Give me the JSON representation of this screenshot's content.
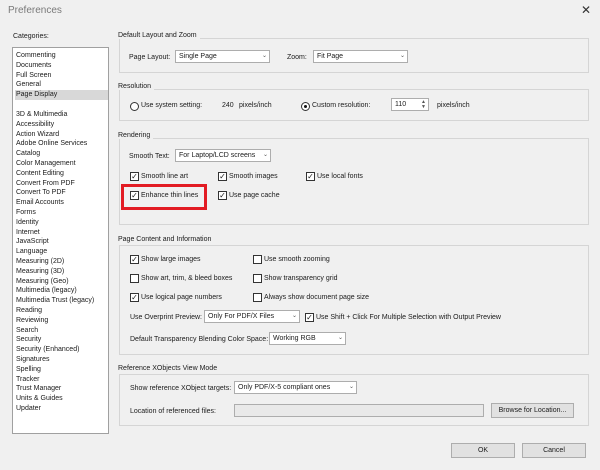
{
  "window": {
    "title": "Preferences",
    "close_glyph": "✕"
  },
  "categories": {
    "label": "Categories:",
    "group1": [
      "Commenting",
      "Documents",
      "Full Screen",
      "General",
      "Page Display"
    ],
    "group2": [
      "3D & Multimedia",
      "Accessibility",
      "Action Wizard",
      "Adobe Online Services",
      "Catalog",
      "Color Management",
      "Content Editing",
      "Convert From PDF",
      "Convert To PDF",
      "Email Accounts",
      "Forms",
      "Identity",
      "Internet",
      "JavaScript",
      "Language",
      "Measuring (2D)",
      "Measuring (3D)",
      "Measuring (Geo)",
      "Multimedia (legacy)",
      "Multimedia Trust (legacy)",
      "Reading",
      "Reviewing",
      "Search",
      "Security",
      "Security (Enhanced)",
      "Signatures",
      "Spelling",
      "Tracker",
      "Trust Manager",
      "Units & Guides",
      "Updater"
    ],
    "selected": "Page Display"
  },
  "layout": {
    "title": "Default Layout and Zoom",
    "page_layout_label": "Page Layout:",
    "page_layout_value": "Single Page",
    "zoom_label": "Zoom:",
    "zoom_value": "Fit Page"
  },
  "resolution": {
    "title": "Resolution",
    "system_label": "Use system setting:",
    "system_value": "240",
    "system_unit": "pixels/inch",
    "custom_label": "Custom resolution:",
    "custom_value": "110",
    "custom_unit": "pixels/inch"
  },
  "rendering": {
    "title": "Rendering",
    "smooth_text_label": "Smooth Text:",
    "smooth_text_value": "For Laptop/LCD screens",
    "smooth_line_art": "Smooth line art",
    "smooth_images": "Smooth images",
    "use_local_fonts": "Use local fonts",
    "enhance_thin_lines": "Enhance thin lines",
    "use_page_cache": "Use page cache"
  },
  "content": {
    "title": "Page Content and Information",
    "show_large_images": "Show large images",
    "use_smooth_zooming": "Use smooth zooming",
    "show_art_trim": "Show art, trim, & bleed boxes",
    "show_transparency_grid": "Show transparency grid",
    "use_logical_page_numbers": "Use logical page numbers",
    "always_show_doc_size": "Always show document page size",
    "overprint_label": "Use Overprint Preview:",
    "overprint_value": "Only For PDF/X Files",
    "shift_click": "Use Shift + Click For Multiple Selection with Output Preview",
    "blending_label": "Default Transparency Blending Color Space:",
    "blending_value": "Working RGB"
  },
  "xobjects": {
    "title": "Reference XObjects View Mode",
    "show_targets_label": "Show reference XObject targets:",
    "show_targets_value": "Only PDF/X-5 compliant ones",
    "location_label": "Location of referenced files:",
    "location_value": "",
    "browse_label": "Browse for Location..."
  },
  "footer": {
    "ok_label": "OK",
    "cancel_label": "Cancel"
  },
  "checked_glyph": "✓",
  "accent_highlight": "#e21b23"
}
